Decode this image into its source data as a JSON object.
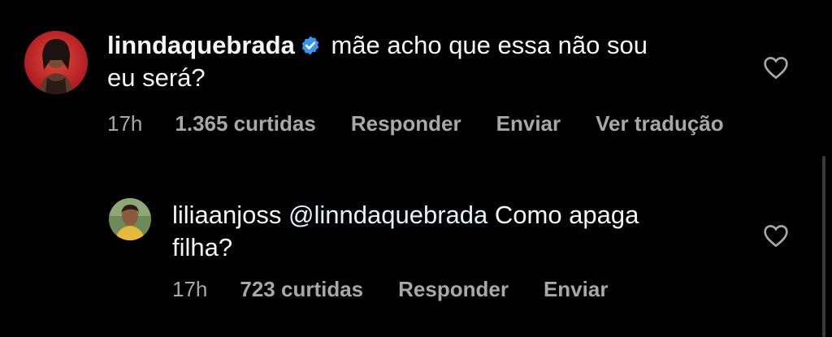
{
  "comments": [
    {
      "username": "linndaquebrada",
      "verified": true,
      "text_line1": "mãe acho que essa não sou",
      "text_line2": "eu será?",
      "time": "17h",
      "likes": "1.365 curtidas",
      "reply_label": "Responder",
      "send_label": "Enviar",
      "translate_label": "Ver tradução"
    },
    {
      "username": "liliaanjoss",
      "verified": false,
      "mention": "@linndaquebrada",
      "text_line1": "Como apaga",
      "text_line2": "filha?",
      "time": "17h",
      "likes": "723 curtidas",
      "reply_label": "Responder",
      "send_label": "Enviar"
    }
  ],
  "colors": {
    "background": "#000000",
    "text": "#f5f5f5",
    "meta": "#a8a8a8",
    "verified": "#3797f0"
  },
  "icons": {
    "verified": "verified-badge-icon",
    "like": "heart-outline-icon"
  }
}
